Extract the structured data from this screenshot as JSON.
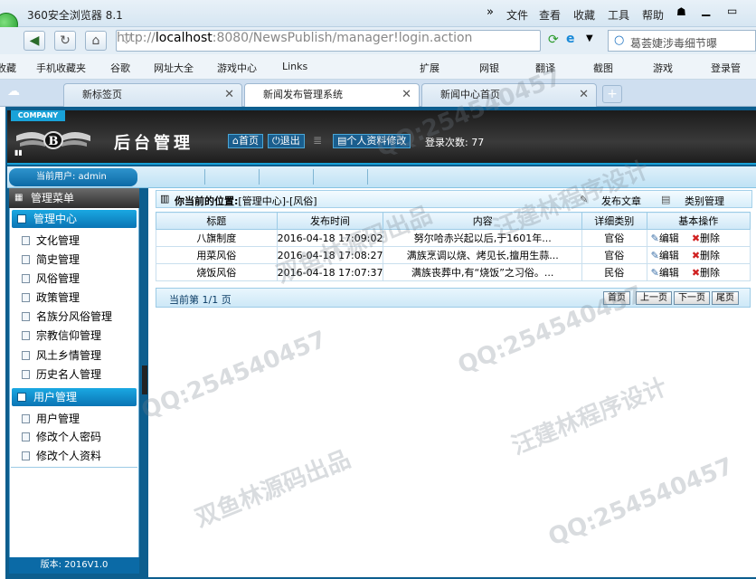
{
  "browser": {
    "title": "360安全浏览器 8.1",
    "menu": [
      "文件",
      "查看",
      "收藏",
      "工具",
      "帮助"
    ],
    "url_prefix": "http://",
    "url_host": "localhost",
    "url_path": ":8080/NewsPublish/manager!login.action",
    "search_text": "葛荟婕涉毒细节曝",
    "favorites": [
      "收藏",
      "手机收藏夹",
      "谷歌",
      "网址大全",
      "游戏中心",
      "Links",
      "扩展",
      "网银",
      "翻译",
      "截图",
      "游戏",
      "登录管"
    ],
    "tabs": [
      {
        "label": "新标签页",
        "active": false
      },
      {
        "label": "新闻发布管理系统",
        "active": true
      },
      {
        "label": "新闻中心首页",
        "active": false
      }
    ]
  },
  "header": {
    "company": "COMPANY",
    "brand": "后台管理",
    "home_label": "首页",
    "logout_label": "退出",
    "profile_label": "个人资料修改",
    "login_count_label": "登录次数:",
    "login_count": "77",
    "current_user": "当前用户: admin"
  },
  "sidebar": {
    "menu_title": "管理菜单",
    "groups": [
      {
        "title": "管理中心",
        "items": [
          "文化管理",
          "简史管理",
          "风俗管理",
          "政策管理",
          "名族分风俗管理",
          "宗教信仰管理",
          "风土乡情管理",
          "历史名人管理"
        ]
      },
      {
        "title": "用户管理",
        "items": [
          "用户管理",
          "修改个人密码",
          "修改个人资料"
        ]
      }
    ],
    "version": "版本: 2016V1.0"
  },
  "main": {
    "location_label": "你当前的位置:",
    "location_value": "[管理中心]-[风俗]",
    "publish_label": "发布文章",
    "category_label": "类别管理",
    "columns": [
      "标题",
      "发布时间",
      "内容",
      "详细类别",
      "基本操作"
    ],
    "rows": [
      {
        "title": "八旗制度",
        "time": "2016-04-18 17:09:02",
        "content": "努尔哈赤兴起以后,于1601年...",
        "category": "官俗"
      },
      {
        "title": "用菜风俗",
        "time": "2016-04-18 17:08:27",
        "content": "满族烹调以烧、烤见长,擅用生蒜...",
        "category": "官俗"
      },
      {
        "title": "烧饭风俗",
        "time": "2016-04-18 17:07:37",
        "content": "满族丧葬中,有“烧饭”之习俗。...",
        "category": "民俗"
      }
    ],
    "edit_label": "编辑",
    "delete_label": "删除",
    "pager_text": "当前第 1/1 页",
    "pager_buttons": [
      "首页",
      "上一页",
      "下一页",
      "尾页"
    ]
  },
  "watermarks": [
    "QQ:254540457",
    "双鱼林源码出品",
    "汪建林程序设计"
  ]
}
